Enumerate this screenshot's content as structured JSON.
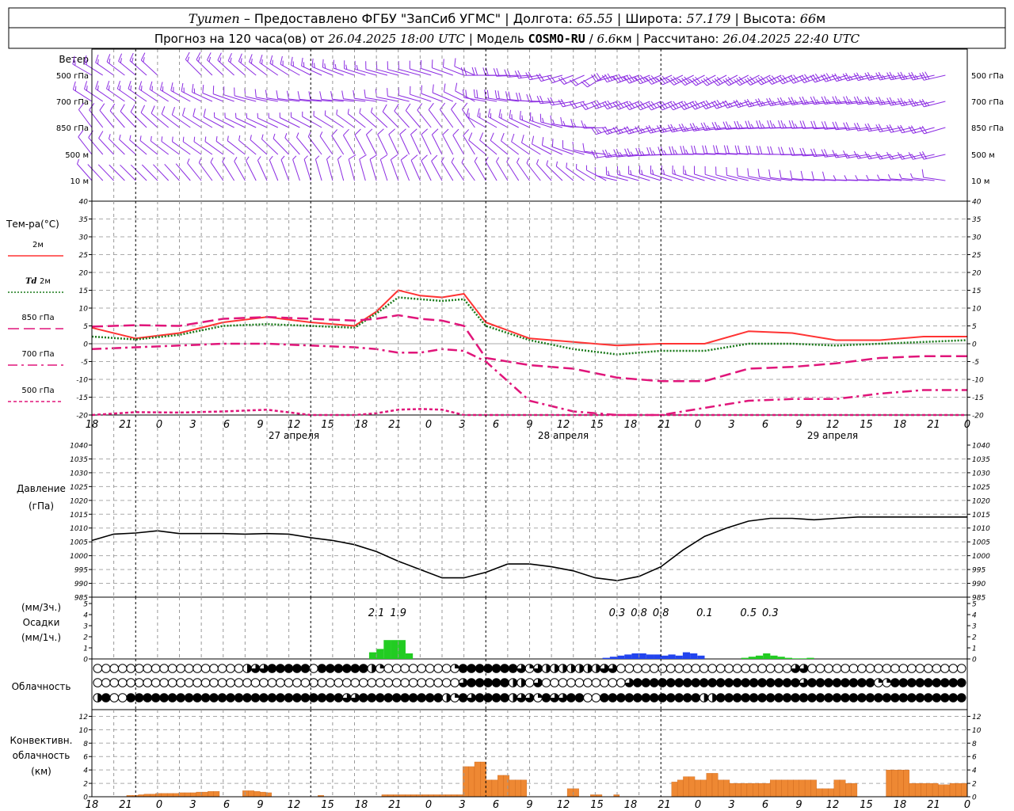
{
  "header": {
    "line1": [
      {
        "t": "Tyumen",
        "style": "it"
      },
      {
        "t": " – Предоставлено ФГБУ \"ЗапСиб УГМС\" | Долгота: ",
        "style": "n"
      },
      {
        "t": "65.55",
        "style": "it"
      },
      {
        "t": " | Широта: ",
        "style": "n"
      },
      {
        "t": "57.179",
        "style": "it"
      },
      {
        "t": " | Высота: ",
        "style": "n"
      },
      {
        "t": "66",
        "style": "it"
      },
      {
        "t": "м",
        "style": "n"
      }
    ],
    "line2": [
      {
        "t": "Прогноз на 120 часа(ов) от ",
        "style": "n"
      },
      {
        "t": "26.04.2025 18:00 UTC",
        "style": "it"
      },
      {
        "t": "  | Модель ",
        "style": "n"
      },
      {
        "t": "COSMO-RU",
        "style": "b"
      },
      {
        "t": " / ",
        "style": "n"
      },
      {
        "t": "6.6",
        "style": "it"
      },
      {
        "t": "км | Рассчитано: ",
        "style": "n"
      },
      {
        "t": "26.04.2025 22:40 UTC",
        "style": "it"
      }
    ]
  },
  "time_axis": {
    "hours": [
      18,
      21,
      0,
      3,
      6,
      9,
      12,
      15,
      18,
      21,
      0,
      3,
      6,
      9,
      12,
      15,
      18,
      21,
      0,
      3,
      6,
      9,
      12,
      15,
      18,
      21,
      0
    ],
    "day_labels": [
      {
        "text": "27 апреля",
        "at_index": 6
      },
      {
        "text": "28 апреля",
        "at_index": 14
      },
      {
        "text": "29 апреля",
        "at_index": 22
      }
    ],
    "day_boundaries": [
      2,
      10,
      18,
      26
    ]
  },
  "wind_panel": {
    "title": "Ветер",
    "levels": [
      "500 гПа",
      "700 гПа",
      "850 гПа",
      "500 м",
      "10 м"
    ],
    "barb_color": "#8b2be2"
  },
  "temp_panel": {
    "title": "Тем-ра(°C)",
    "ylim": [
      -20,
      40
    ],
    "yticks": [
      -20,
      -15,
      -10,
      -5,
      0,
      5,
      10,
      15,
      20,
      25,
      30,
      35,
      40
    ],
    "legend": [
      {
        "name": "2м",
        "prefix": "",
        "color": "#ff3333",
        "dash": "solid"
      },
      {
        "name": "2м",
        "prefix": "Td",
        "color": "#1a7a1a",
        "dash": "dotted"
      },
      {
        "name": "850 гПа",
        "prefix": "",
        "color": "#e0157a",
        "dash": "long"
      },
      {
        "name": "700 гПа",
        "prefix": "",
        "color": "#e0157a",
        "dash": "dashdot"
      },
      {
        "name": "500 гПа",
        "prefix": "",
        "color": "#e0157a",
        "dash": "short"
      }
    ]
  },
  "pressure_panel": {
    "title1": "Давление",
    "title2": "(гПа)",
    "ylim": [
      985,
      1040
    ],
    "yticks": [
      985,
      990,
      995,
      1000,
      1005,
      1010,
      1015,
      1020,
      1025,
      1030,
      1035,
      1040
    ]
  },
  "precip_panel": {
    "title1": "(мм/3ч.)",
    "title2": "Осадки",
    "title3": "(мм/1ч.)",
    "ylim": [
      0,
      5
    ],
    "yticks": [
      0,
      1,
      2,
      3,
      4,
      5
    ],
    "totals": [
      {
        "text": "2.1",
        "hour": 39
      },
      {
        "text": "1.9",
        "hour": 42
      },
      {
        "text": "0.3",
        "hour": 72
      },
      {
        "text": "0.8",
        "hour": 75
      },
      {
        "text": "0.8",
        "hour": 78
      },
      {
        "text": "0.1",
        "hour": 84
      },
      {
        "text": "0.5",
        "hour": 90
      },
      {
        "text": "0.3",
        "hour": 93
      }
    ]
  },
  "cloud_panel": {
    "title": "Облачность",
    "rows": [
      "000000000000000000233444445444444210000000014444444313222222233000000000000000000000330000000000000000000",
      "000000000000000000000000000000000000000000003444442203000000000034444444444444444444434444444411444444444",
      "240044444444444444444444444444334444444444214344442331433440044444444444422444444444444444444444444444444"
    ]
  },
  "conv_panel": {
    "title1": "Конвективн.",
    "title2": "облачность",
    "title3": "(км)",
    "ylim": [
      0,
      13
    ],
    "yticks": [
      0,
      2,
      4,
      6,
      8,
      10,
      12
    ]
  },
  "chart_data": [
    {
      "type": "line",
      "title": "Тем-ра(°C)",
      "x_unit": "hours from 26.04.2025 18:00 UTC",
      "x": [
        0,
        6,
        12,
        18,
        24,
        30,
        36,
        39,
        42,
        45,
        48,
        51,
        54,
        60,
        66,
        72,
        78,
        84,
        90,
        96,
        102,
        108,
        114,
        120
      ],
      "ylim": [
        -20,
        40
      ],
      "series": [
        {
          "name": "2м",
          "values": [
            4.5,
            1.5,
            3,
            6,
            7.5,
            6,
            5,
            9,
            15,
            13.5,
            13,
            14,
            6,
            1.5,
            0.5,
            -0.5,
            0,
            0,
            3.5,
            3,
            1,
            1,
            2,
            2
          ]
        },
        {
          "name": "Td 2м",
          "values": [
            2,
            1.2,
            2.5,
            5,
            5.5,
            5,
            4.5,
            8.5,
            13,
            12.5,
            12,
            12.5,
            5,
            1,
            -1.5,
            -3,
            -2,
            -2,
            0,
            0,
            -0.5,
            0,
            0.5,
            1
          ]
        },
        {
          "name": "850 гПа",
          "values": [
            4.8,
            5.2,
            5,
            7,
            7.5,
            7,
            6.5,
            7,
            8,
            7,
            6.5,
            5,
            -4,
            -6,
            -7,
            -9.5,
            -10.5,
            -10.5,
            -7,
            -6.5,
            -5.5,
            -4,
            -3.5,
            -3.5
          ]
        },
        {
          "name": "700 гПа",
          "values": [
            -1.5,
            -1,
            -0.5,
            0,
            0,
            -0.5,
            -1,
            -1.5,
            -2.5,
            -2.5,
            -1.5,
            -2,
            -5,
            -16,
            -19,
            -21,
            -22,
            -18,
            -16,
            -15.5,
            -15.5,
            -14,
            -13,
            -13
          ]
        },
        {
          "name": "500 гПа",
          "values": [
            -20.5,
            -19.2,
            -19.3,
            -19,
            -18.5,
            -20.5,
            -20.5,
            -19.5,
            -18.5,
            -18.3,
            -18.5,
            -20,
            -22,
            -22,
            -22,
            -22,
            -22,
            -22,
            -22,
            -22,
            -22,
            -22,
            -22,
            -22
          ]
        }
      ]
    },
    {
      "type": "line",
      "title": "Давление (гПа)",
      "x_unit": "hours from 26.04.2025 18:00 UTC",
      "x": [
        0,
        3,
        6,
        9,
        12,
        15,
        18,
        21,
        24,
        27,
        30,
        33,
        36,
        39,
        42,
        45,
        48,
        51,
        54,
        57,
        60,
        63,
        66,
        69,
        72,
        75,
        78,
        81,
        84,
        87,
        90,
        93,
        96,
        99,
        102,
        105,
        108,
        111,
        114,
        117,
        120
      ],
      "ylim": [
        985,
        1040
      ],
      "values": [
        1005.5,
        1007.8,
        1008.2,
        1009,
        1008,
        1008,
        1008,
        1007.8,
        1008,
        1007.8,
        1006.5,
        1005.5,
        1004,
        1001.5,
        998,
        995,
        992,
        992,
        994,
        997,
        997,
        996,
        994.5,
        992,
        991,
        992.5,
        996,
        1002,
        1007,
        1010,
        1012.5,
        1013.5,
        1013.5,
        1013,
        1013.5,
        1014,
        1014,
        1014,
        1014,
        1014,
        1014
      ]
    },
    {
      "type": "bar",
      "title": "Осадки (мм/1ч.)",
      "x_unit": "hour index",
      "ylim": [
        0,
        5
      ],
      "series": [
        {
          "name": "rain",
          "color": "#22cc22",
          "points": [
            [
              38,
              0.6
            ],
            [
              39,
              0.9
            ],
            [
              40,
              1.7
            ],
            [
              41,
              1.7
            ],
            [
              42,
              1.7
            ],
            [
              43,
              0.5
            ],
            [
              89,
              0.1
            ],
            [
              90,
              0.2
            ],
            [
              91,
              0.3
            ],
            [
              92,
              0.5
            ],
            [
              93,
              0.3
            ],
            [
              94,
              0.2
            ],
            [
              95,
              0.1
            ],
            [
              96,
              0.05
            ],
            [
              97,
              0.05
            ],
            [
              98,
              0.1
            ]
          ]
        },
        {
          "name": "snow",
          "color": "#2244ee",
          "points": [
            [
              70,
              0.1
            ],
            [
              71,
              0.2
            ],
            [
              72,
              0.3
            ],
            [
              73,
              0.4
            ],
            [
              74,
              0.5
            ],
            [
              75,
              0.5
            ],
            [
              76,
              0.4
            ],
            [
              77,
              0.4
            ],
            [
              78,
              0.3
            ],
            [
              79,
              0.4
            ],
            [
              80,
              0.3
            ],
            [
              81,
              0.6
            ],
            [
              82,
              0.5
            ],
            [
              83,
              0.3
            ]
          ]
        }
      ]
    },
    {
      "type": "bar",
      "title": "Конвективн. облачность (км)",
      "x_unit": "hour index",
      "ylim": [
        0,
        13
      ],
      "color": "#ee8833",
      "values": [
        0,
        0,
        0,
        0,
        0,
        0,
        0.2,
        0.2,
        0.3,
        0.4,
        0.4,
        0.5,
        0.5,
        0.5,
        0.5,
        0.6,
        0.6,
        0.6,
        0.7,
        0.7,
        0.8,
        0.8,
        0,
        0,
        0,
        0,
        0.9,
        0.9,
        0.8,
        0.7,
        0.6,
        0,
        0,
        0,
        0,
        0,
        0,
        0,
        0,
        0.2,
        0,
        0,
        0,
        0,
        0,
        0,
        0,
        0,
        0,
        0,
        0.3,
        0.3,
        0.3,
        0.3,
        0.3,
        0.3,
        0.3,
        0.3,
        0.3,
        0.3,
        0.3,
        0.3,
        0.3,
        0.3,
        4.5,
        4.5,
        5.2,
        5.2,
        2.5,
        2.5,
        3.2,
        3.2,
        2.5,
        2.5,
        2.5,
        0,
        0,
        0,
        0,
        0,
        0,
        0,
        1.2,
        1.2,
        0,
        0,
        0.3,
        0.3,
        0,
        0,
        0.3,
        0,
        0,
        0,
        0,
        0,
        0,
        0,
        0,
        0,
        2.2,
        2.5,
        3,
        3,
        2.5,
        2.5,
        3.5,
        3.5,
        2.5,
        2.5,
        2,
        2,
        2,
        2,
        2,
        2,
        2,
        2.5,
        2.5,
        2.5,
        2.5,
        2.5,
        2.5,
        2.5,
        2.5,
        1.2,
        1.2,
        1.2,
        2.5,
        2.5,
        2,
        2,
        0,
        0,
        0,
        0,
        0,
        4,
        4,
        4,
        4,
        2,
        2,
        2,
        2,
        2,
        1.8,
        1.8,
        2,
        2,
        2
      ]
    }
  ]
}
